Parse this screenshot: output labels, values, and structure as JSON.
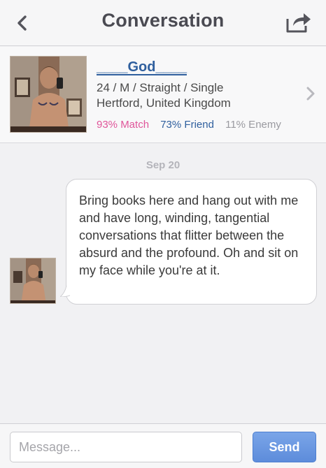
{
  "nav": {
    "title": "Conversation",
    "back_icon": "chevron-left-icon",
    "share_icon": "share-icon"
  },
  "profile": {
    "name": "____God____",
    "details": "24 / M / Straight / Single",
    "location": "Hertford, United Kingdom",
    "match": "93% Match",
    "friend": "73% Friend",
    "enemy": "11% Enemy",
    "colors": {
      "match": "#e0559a",
      "friend": "#2f5f9e",
      "enemy": "#9a9aa0"
    }
  },
  "thread": {
    "date": "Sep 20",
    "messages": [
      {
        "text": "Bring books here and hang out with me and have long, winding, tangential conversations that flitter between the absurd and the profound. Oh and sit on my face while you're at it."
      }
    ]
  },
  "composer": {
    "placeholder": "Message...",
    "send_label": "Send",
    "send_color": "#5d8cdb"
  }
}
